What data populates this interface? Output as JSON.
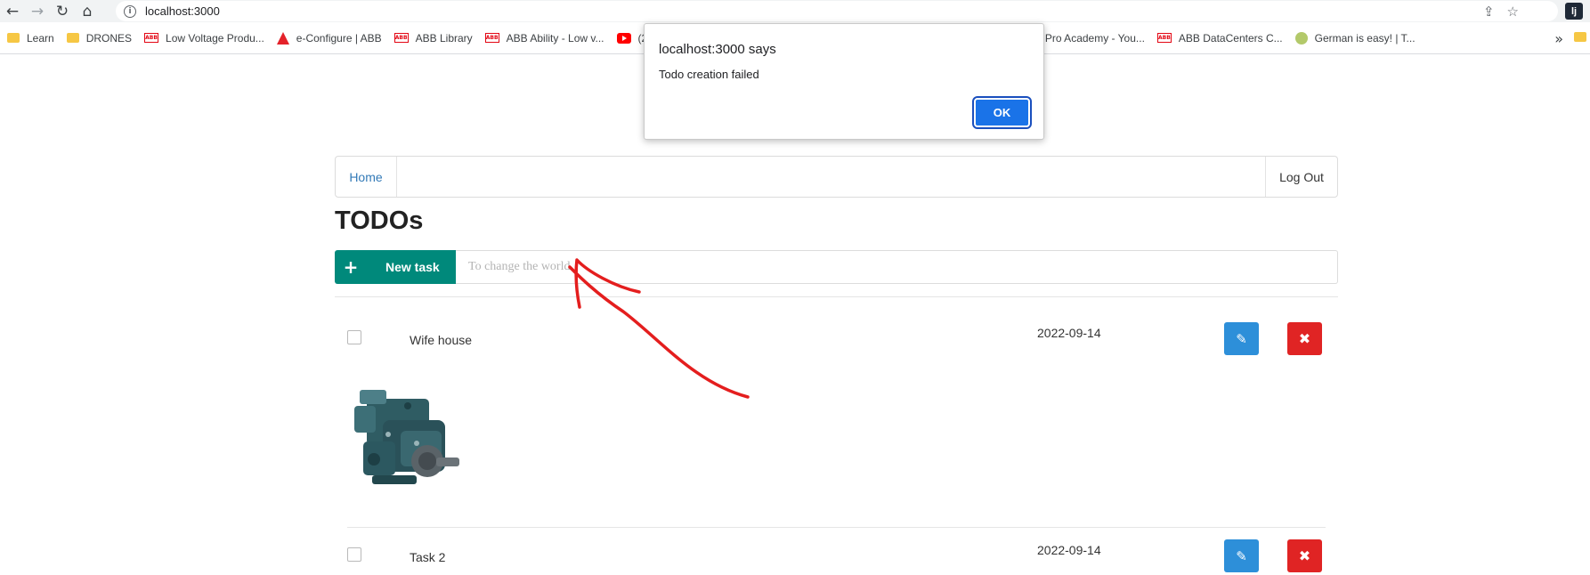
{
  "browser": {
    "url": "localhost:3000",
    "nav": {
      "back_icon": "back-arrow-icon",
      "forward_icon": "forward-arrow-icon",
      "reload_icon": "reload-icon",
      "home_icon": "home-icon"
    },
    "extension_label": "lj",
    "bookmarks": [
      {
        "label": "Learn",
        "icon": "folder"
      },
      {
        "label": "DRONES",
        "icon": "folder"
      },
      {
        "label": "Low Voltage Produ...",
        "icon": "abb"
      },
      {
        "label": "e-Configure | ABB",
        "icon": "adobe"
      },
      {
        "label": "ABB Library",
        "icon": "abb"
      },
      {
        "label": "ABB Ability - Low v...",
        "icon": "abb"
      },
      {
        "label": "(2",
        "icon": "youtube"
      },
      {
        "label": "iPro Academy - You...",
        "icon": "none"
      },
      {
        "label": "ABB DataCenters C...",
        "icon": "abb"
      },
      {
        "label": "German is easy! | T...",
        "icon": "face"
      }
    ],
    "abb_badge": "ABB",
    "more_label": "»"
  },
  "dialog": {
    "title": "localhost:3000 says",
    "message": "Todo creation failed",
    "ok_label": "OK"
  },
  "navbar": {
    "home_label": "Home",
    "logout_label": "Log Out"
  },
  "page": {
    "title": "TODOs",
    "new_task_label": "New task",
    "new_task_icon": "+",
    "input_placeholder": "To change the world."
  },
  "todos": [
    {
      "name": "Wife house",
      "date": "2022-09-14",
      "checked": false,
      "has_image": true,
      "image_alt": "hydraulic-pump"
    },
    {
      "name": "Task 2",
      "date": "2022-09-14",
      "checked": false,
      "has_image": false
    }
  ],
  "icons": {
    "edit": "✎",
    "delete": "✖"
  },
  "colors": {
    "accent_teal": "#00897b",
    "edit_blue": "#2d8fd9",
    "delete_red": "#e02424",
    "link_blue": "#337ab7",
    "annotation_red": "#e41e1e",
    "dialog_button": "#1a73e8"
  }
}
